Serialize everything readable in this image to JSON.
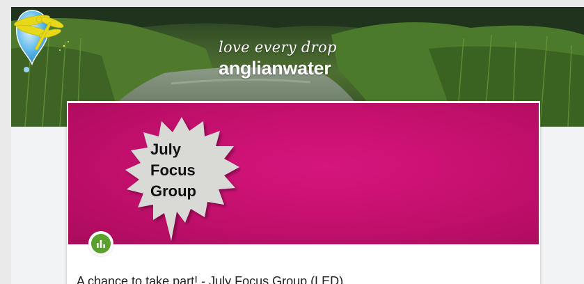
{
  "banner": {
    "slogan": "love every drop",
    "brand": "anglianwater",
    "brand_color": "#ffffff",
    "icons": [
      "water-drop-icon",
      "dragonfly-icon"
    ]
  },
  "card": {
    "image_text": [
      "July",
      "Focus",
      "Group"
    ],
    "image_background": "#c7106f",
    "badge_icon": "poll-chart-icon",
    "badge_color": "#5aa02c",
    "title": "A chance to take part! - July Focus Group (LED)"
  }
}
